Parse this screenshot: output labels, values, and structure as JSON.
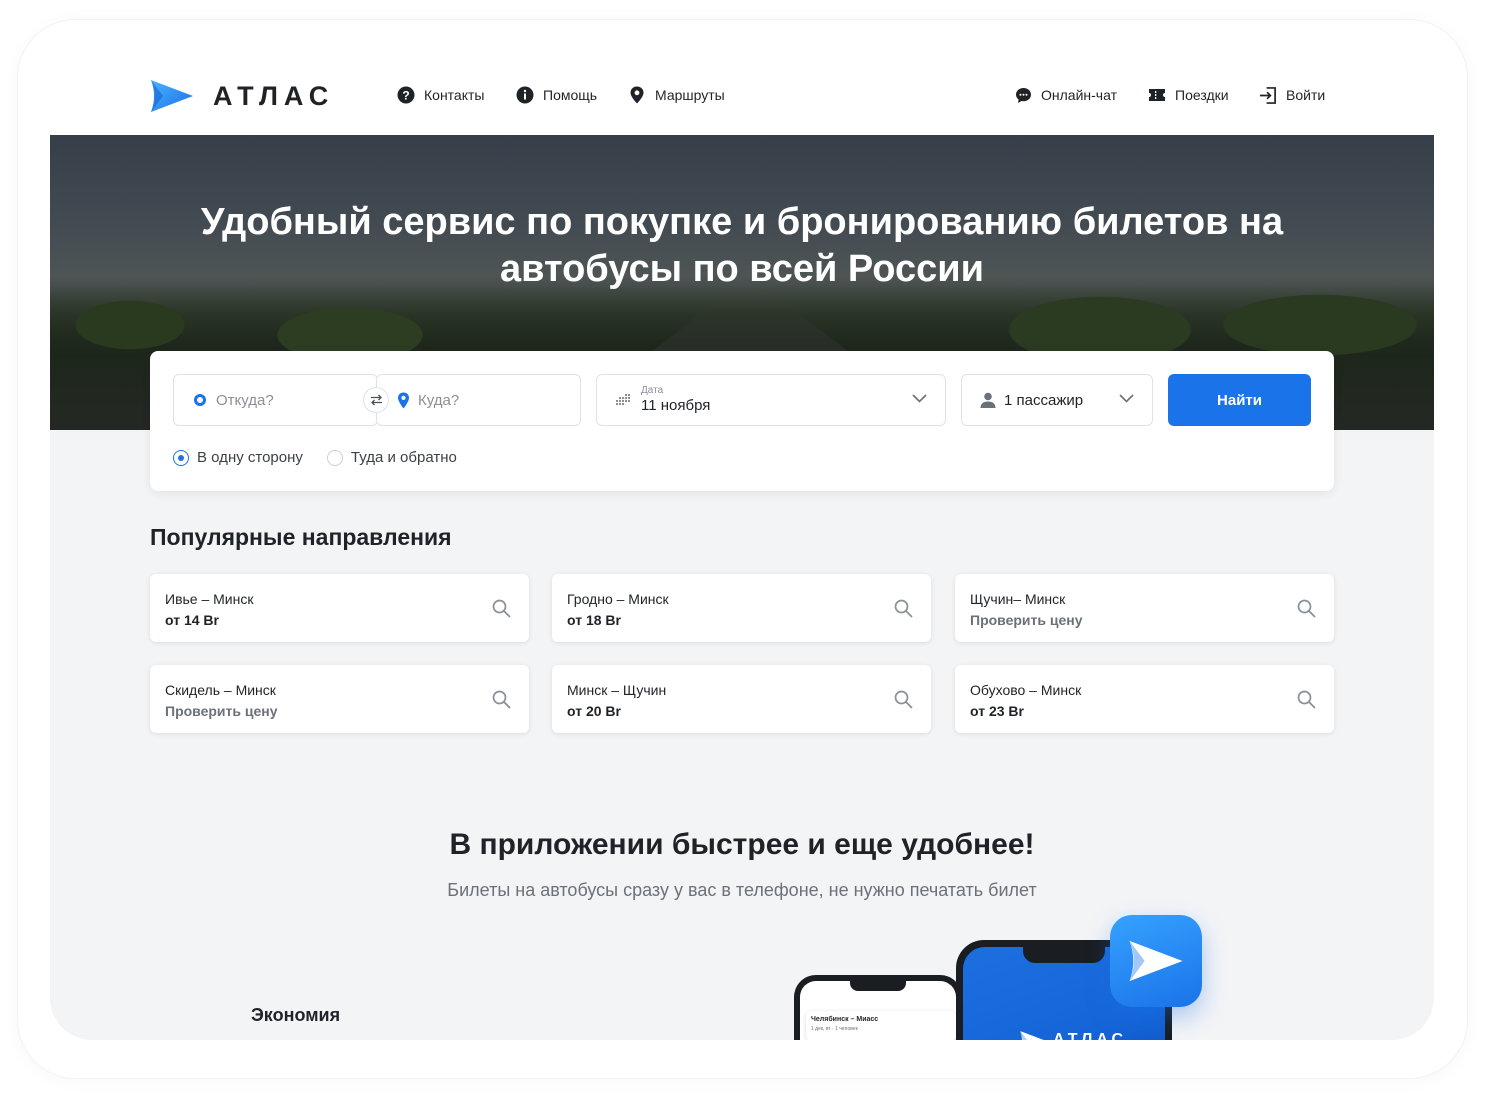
{
  "brand": {
    "name": "АТЛАС",
    "accent": "#1a73e8"
  },
  "nav_left": [
    {
      "label": "Контакты",
      "icon": "question-circle-icon"
    },
    {
      "label": "Помощь",
      "icon": "info-circle-icon"
    },
    {
      "label": "Маршруты",
      "icon": "map-pin-icon"
    }
  ],
  "nav_right": [
    {
      "label": "Онлайн-чат",
      "icon": "chat-bubble-icon"
    },
    {
      "label": "Поездки",
      "icon": "ticket-icon"
    },
    {
      "label": "Войти",
      "icon": "login-icon"
    }
  ],
  "hero": {
    "title_line1": "Удобный сервис по покупке и бронированию билетов на",
    "title_line2": "автобусы по всей России"
  },
  "search": {
    "from_placeholder": "Откуда?",
    "to_placeholder": "Куда?",
    "date_label": "Дата",
    "date_value": "11 ноября",
    "passengers": "1 пассажир",
    "find_button": "Найти",
    "trip_types": [
      {
        "label": "В одну сторону",
        "selected": true
      },
      {
        "label": "Туда и обратно",
        "selected": false
      }
    ]
  },
  "popular": {
    "title": "Популярные направления",
    "routes": [
      {
        "name": "Ивье – Минск",
        "price": "от 14 Br"
      },
      {
        "name": "Гродно – Минск",
        "price": "от 18 Br"
      },
      {
        "name": "Щучин– Минск",
        "price": "Проверить цену"
      },
      {
        "name": "Скидель – Минск",
        "price": "Проверить цену"
      },
      {
        "name": "Минск – Щучин",
        "price": "от 20 Br"
      },
      {
        "name": "Обухово – Минск",
        "price": "от 23 Br"
      }
    ]
  },
  "app_promo": {
    "title": "В приложении быстрее и еще удобнее!",
    "subtitle": "Билеты на автобусы сразу у вас в телефоне, не нужно печатать билет",
    "feature_title": "Экономия",
    "phone_back_route": "Челябинск – Миасс",
    "phone_back_sub": "1 дек, вт · 1 человек",
    "phone_front_logo": "АТЛАС"
  }
}
